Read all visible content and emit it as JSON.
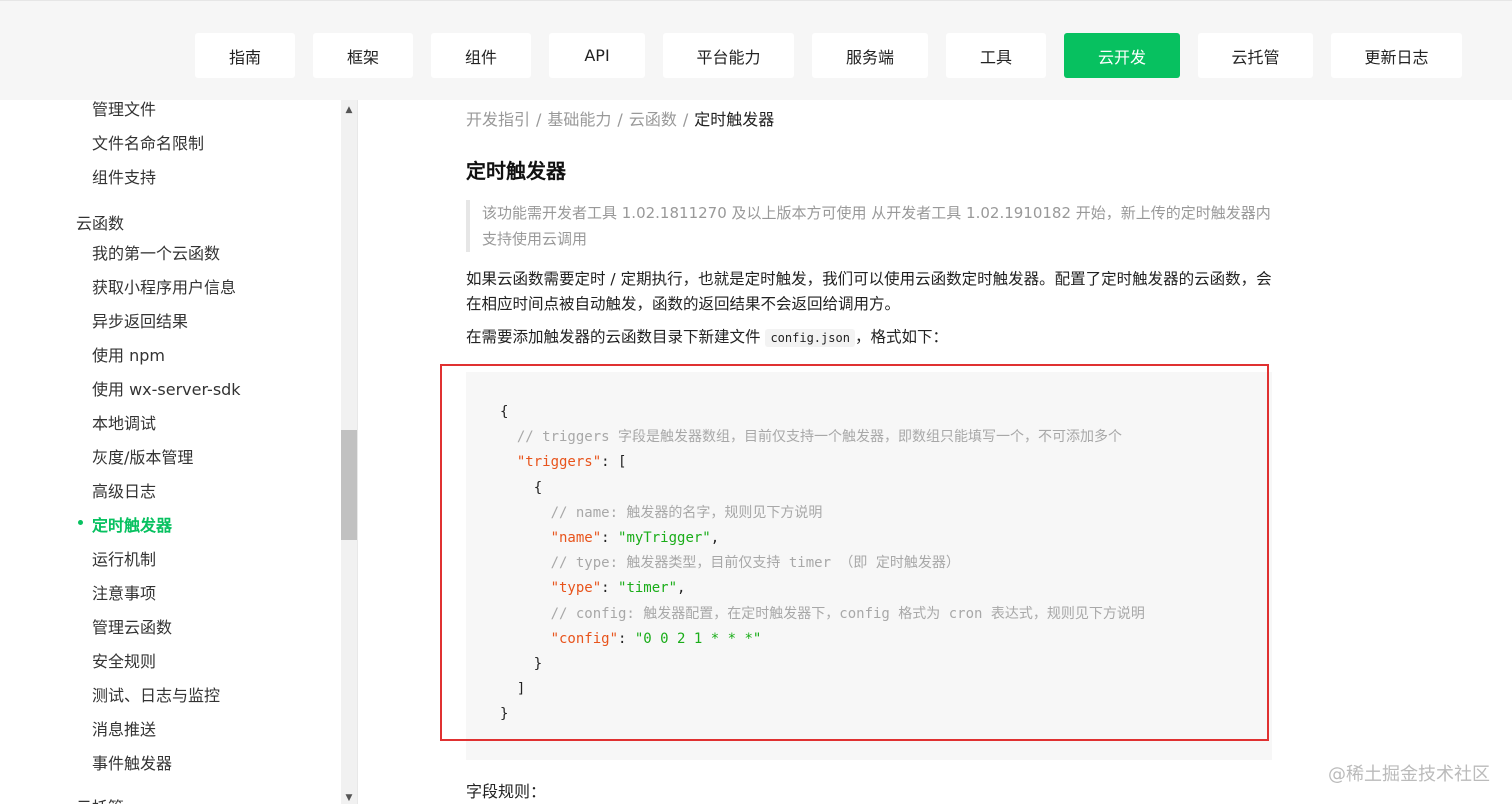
{
  "nav": {
    "tabs": [
      {
        "label": "指南"
      },
      {
        "label": "框架"
      },
      {
        "label": "组件"
      },
      {
        "label": "API"
      },
      {
        "label": "平台能力"
      },
      {
        "label": "服务端"
      },
      {
        "label": "工具"
      },
      {
        "label": "云开发"
      },
      {
        "label": "云托管"
      },
      {
        "label": "更新日志"
      }
    ],
    "active_tab": "云开发",
    "accent_color": "#07c160"
  },
  "sidebar": {
    "items": [
      {
        "label": "管理文件"
      },
      {
        "label": "文件名命名限制"
      },
      {
        "label": "组件支持"
      },
      {
        "label": "云函数"
      },
      {
        "label": "我的第一个云函数"
      },
      {
        "label": "获取小程序用户信息"
      },
      {
        "label": "异步返回结果"
      },
      {
        "label": "使用 npm"
      },
      {
        "label": "使用 wx-server-sdk"
      },
      {
        "label": "本地调试"
      },
      {
        "label": "灰度/版本管理"
      },
      {
        "label": "高级日志"
      },
      {
        "label": "定时触发器"
      },
      {
        "label": "运行机制"
      },
      {
        "label": "注意事项"
      },
      {
        "label": "管理云函数"
      },
      {
        "label": "安全规则"
      },
      {
        "label": "测试、日志与监控"
      },
      {
        "label": "消息推送"
      },
      {
        "label": "事件触发器"
      },
      {
        "label": "云托管"
      }
    ],
    "active_item": "定时触发器"
  },
  "breadcrumb": [
    "开发指引",
    "基础能力",
    "云函数",
    "定时触发器"
  ],
  "page_title": "定时触发器",
  "notice": "该功能需开发者工具 1.02.1811270 及以上版本方可使用 从开发者工具 1.02.1910182 开始，新上传的定时触发器内支持使用云调用",
  "intro": "如果云函数需要定时 / 定期执行，也就是定时触发，我们可以使用云函数定时触发器。配置了定时触发器的云函数，会在相应时间点被自动触发，函数的返回结果不会返回给调用方。",
  "config_line": {
    "before": "在需要添加触发器的云函数目录下新建文件",
    "code": "config.json",
    "after": "，格式如下："
  },
  "code": {
    "open_brace": "{",
    "comment1": "// triggers 字段是触发器数组，目前仅支持一个触发器，即数组只能填写一个，不可添加多个",
    "triggers_key": "\"triggers\"",
    "open_bracket": "[",
    "inner_open": "{",
    "comment2": "// name: 触发器的名字，规则见下方说明",
    "name_key": "\"name\"",
    "name_val": "\"myTrigger\"",
    "comment3": "// type: 触发器类型，目前仅支持 timer （即 定时触发器）",
    "type_key": "\"type\"",
    "type_val": "\"timer\"",
    "comment4": "// config: 触发器配置，在定时触发器下，config 格式为 cron 表达式，规则见下方说明",
    "config_key": "\"config\"",
    "config_val": "\"0 0 2 1 * * *\"",
    "inner_close": "}",
    "close_bracket": "]",
    "close_brace": "}"
  },
  "field_rules": "字段规则：",
  "watermark": "@稀土掘金技术社区"
}
